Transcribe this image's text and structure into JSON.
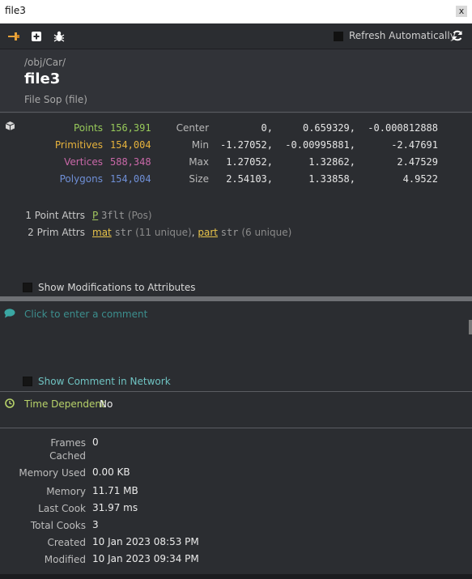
{
  "window": {
    "title": "file3",
    "close_label": "x"
  },
  "toolbar": {
    "pin_icon": "pin-icon",
    "add_icon": "plus-square-icon",
    "debug_icon": "bug-icon",
    "refresh_label": "Refresh Automatically",
    "refresh_checked": false,
    "refresh_icon": "refresh-icon"
  },
  "header": {
    "path": "/obj/Car/",
    "name": "file3",
    "type": "File Sop (file)"
  },
  "counts": [
    {
      "label": "Points",
      "value": "156,391",
      "color": "#97c95a"
    },
    {
      "label": "Primitives",
      "value": "154,004",
      "color": "#e6b23c"
    },
    {
      "label": "Vertices",
      "value": "588,348",
      "color": "#c968a8"
    },
    {
      "label": "Polygons",
      "value": "154,004",
      "color": "#6f8fd6"
    }
  ],
  "bbox": [
    {
      "label": "Center",
      "x": "0,",
      "y": "0.659329,",
      "z": "-0.000812888"
    },
    {
      "label": "Min",
      "x": "-1.27052,",
      "y": "-0.00995881,",
      "z": "-2.47691"
    },
    {
      "label": "Max",
      "x": "1.27052,",
      "y": "1.32862,",
      "z": "2.47529"
    },
    {
      "label": "Size",
      "x": "2.54103,",
      "y": "1.33858,",
      "z": "4.9522"
    }
  ],
  "attributes": {
    "point_label": "1 Point Attrs",
    "point_attrs": [
      {
        "name": "P",
        "type": "3flt",
        "note": "(Pos)"
      }
    ],
    "prim_label": "2 Prim Attrs",
    "prim_attrs": [
      {
        "name": "mat",
        "type": "str",
        "note": "(11 unique)"
      },
      {
        "name": "part",
        "type": "str",
        "note": "(6 unique)"
      }
    ],
    "separator": ","
  },
  "show_modifications": {
    "label": "Show Modifications to Attributes",
    "checked": false
  },
  "comment": {
    "placeholder": "Click to enter a comment",
    "show_in_network_label": "Show Comment in Network",
    "show_in_network_checked": false
  },
  "time_dependent": {
    "label": "Time Dependent",
    "value": "No"
  },
  "info": [
    {
      "label": "Frames\nCached",
      "value": "0"
    },
    {
      "label": "Memory Used",
      "value": "0.00 KB"
    },
    {
      "label": "Memory",
      "value": "11.71 MB"
    },
    {
      "label": "Last Cook",
      "value": "31.97 ms"
    },
    {
      "label": "Total Cooks",
      "value": "3"
    },
    {
      "label": "Created",
      "value": "10 Jan 2023 08:53 PM"
    },
    {
      "label": "Modified",
      "value": "10 Jan 2023 09:34 PM"
    }
  ]
}
